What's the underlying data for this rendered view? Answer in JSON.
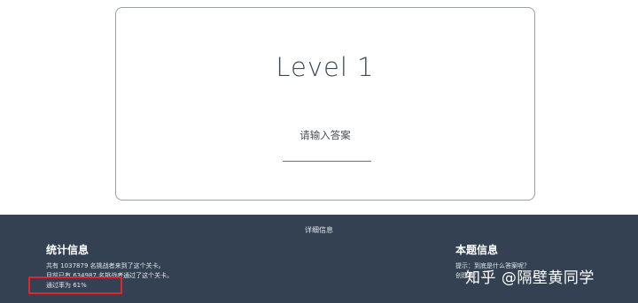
{
  "card": {
    "level_title": "Level 1",
    "answer_prompt": "请输入答案",
    "answer_input_value": ""
  },
  "footer": {
    "title": "详细信息",
    "stats": {
      "heading": "统计信息",
      "line1": "共有 1037879 名挑战者来到了这个关卡。",
      "line2": "目前已有 634987 名挑战者通过了这个关卡。",
      "pass_rate": "通过率为 61%"
    },
    "hint": {
      "heading": "本题信息",
      "line1": "提示：到底是什么答案呢？",
      "line2": "创建者：..."
    }
  },
  "watermark": {
    "text": "知乎 @隔壁黄同学"
  },
  "colors": {
    "footer_bg": "#334152",
    "highlight_box": "#e0262b"
  }
}
